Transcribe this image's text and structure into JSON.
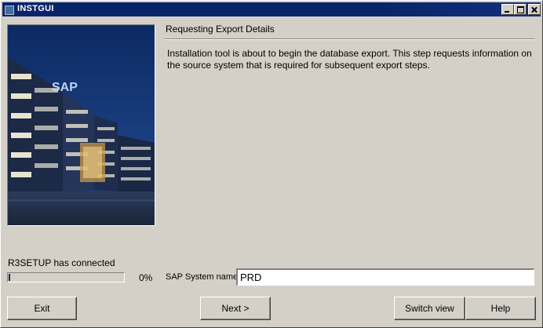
{
  "window": {
    "title": "INSTGUI"
  },
  "main": {
    "section_title": "Requesting Export Details",
    "description": "Installation tool is about to begin the database export. This step requests information on the source system that is required for subsequent export steps."
  },
  "photo": {
    "logo_text": "SAP"
  },
  "status": {
    "text": "R3SETUP has connected",
    "progress_percent": 0,
    "progress_label": "0%"
  },
  "form": {
    "system_name_label": "SAP System name",
    "system_name_value": "PRD"
  },
  "buttons": {
    "exit": "Exit",
    "next": "Next >",
    "switch_view": "Switch view",
    "help": "Help"
  },
  "colors": {
    "titlebar": "#0a246a",
    "face": "#d4d0c8"
  }
}
